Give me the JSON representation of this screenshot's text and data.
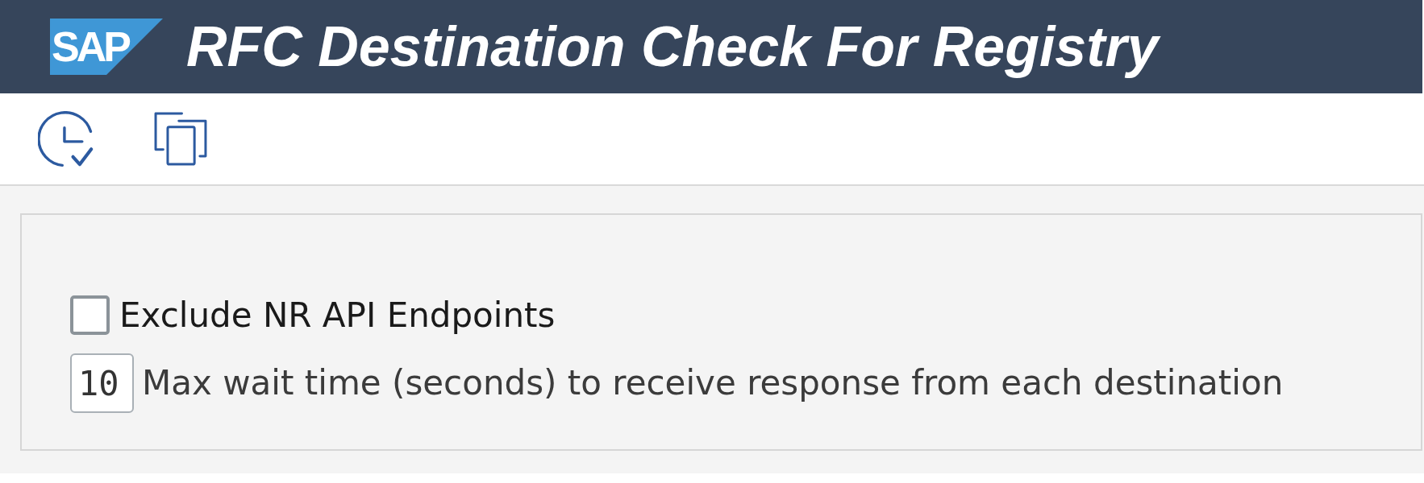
{
  "header": {
    "logo": "SAP",
    "title": "RFC Destination Check For Registry"
  },
  "form": {
    "options": [
      {
        "kind": "checkbox",
        "label": "Exclude NR API Endpoints",
        "checked": false
      },
      {
        "kind": "number",
        "value": "10",
        "label": "Max wait time (seconds) to receive response from each destination"
      }
    ]
  }
}
